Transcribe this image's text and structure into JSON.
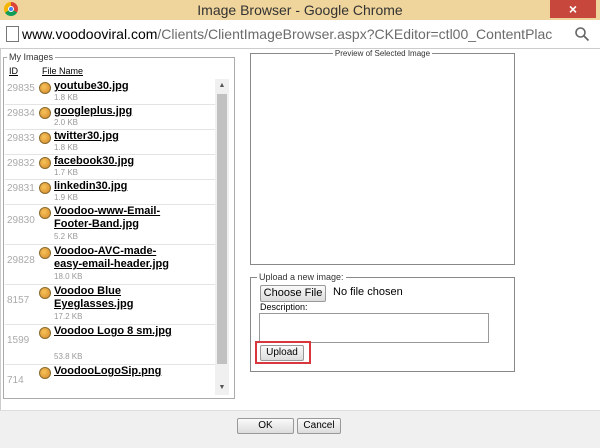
{
  "window": {
    "title": "Image Browser - Google Chrome",
    "close_glyph": "×",
    "url_host": "www.voodooviral.com",
    "url_path": "/Clients/ClientImageBrowser.aspx?CKEditor=ctl00_ContentPlac"
  },
  "my_images": {
    "legend": "My Images",
    "col_id": "ID",
    "col_name": "File Name",
    "rows": [
      {
        "id": "29835",
        "name": "youtube30.jpg",
        "size": "1.8 KB"
      },
      {
        "id": "29834",
        "name": "googleplus.jpg",
        "size": "2.0 KB"
      },
      {
        "id": "29833",
        "name": "twitter30.jpg",
        "size": "1.8 KB"
      },
      {
        "id": "29832",
        "name": "facebook30.jpg",
        "size": "1.7 KB"
      },
      {
        "id": "29831",
        "name": "linkedin30.jpg",
        "size": "1.9 KB"
      },
      {
        "id": "29830",
        "name": "Voodoo-www-Email-Footer-Band.jpg",
        "size": "5.2 KB"
      },
      {
        "id": "29828",
        "name": "Voodoo-AVC-made-easy-email-header.jpg",
        "size": "18.0 KB"
      },
      {
        "id": "8157",
        "name": "Voodoo Blue Eyeglasses.jpg",
        "size": "17.2 KB"
      },
      {
        "id": "1599",
        "name": "Voodoo Logo 8 sm.jpg",
        "size": "53.8 KB"
      },
      {
        "id": "714",
        "name": "VoodooLogoSip.png",
        "size": ""
      }
    ]
  },
  "preview": {
    "legend": "Preview of Selected Image"
  },
  "upload": {
    "legend": "Upload a new image:",
    "choose_label": "Choose File",
    "no_file": "No file chosen",
    "description_label": "Description:",
    "description_value": "",
    "upload_label": "Upload"
  },
  "footer": {
    "ok_label": "OK",
    "cancel_label": "Cancel"
  },
  "colors": {
    "title_bar": "#efd49b",
    "close_button": "#c7473d",
    "highlight": "#d9373e"
  }
}
